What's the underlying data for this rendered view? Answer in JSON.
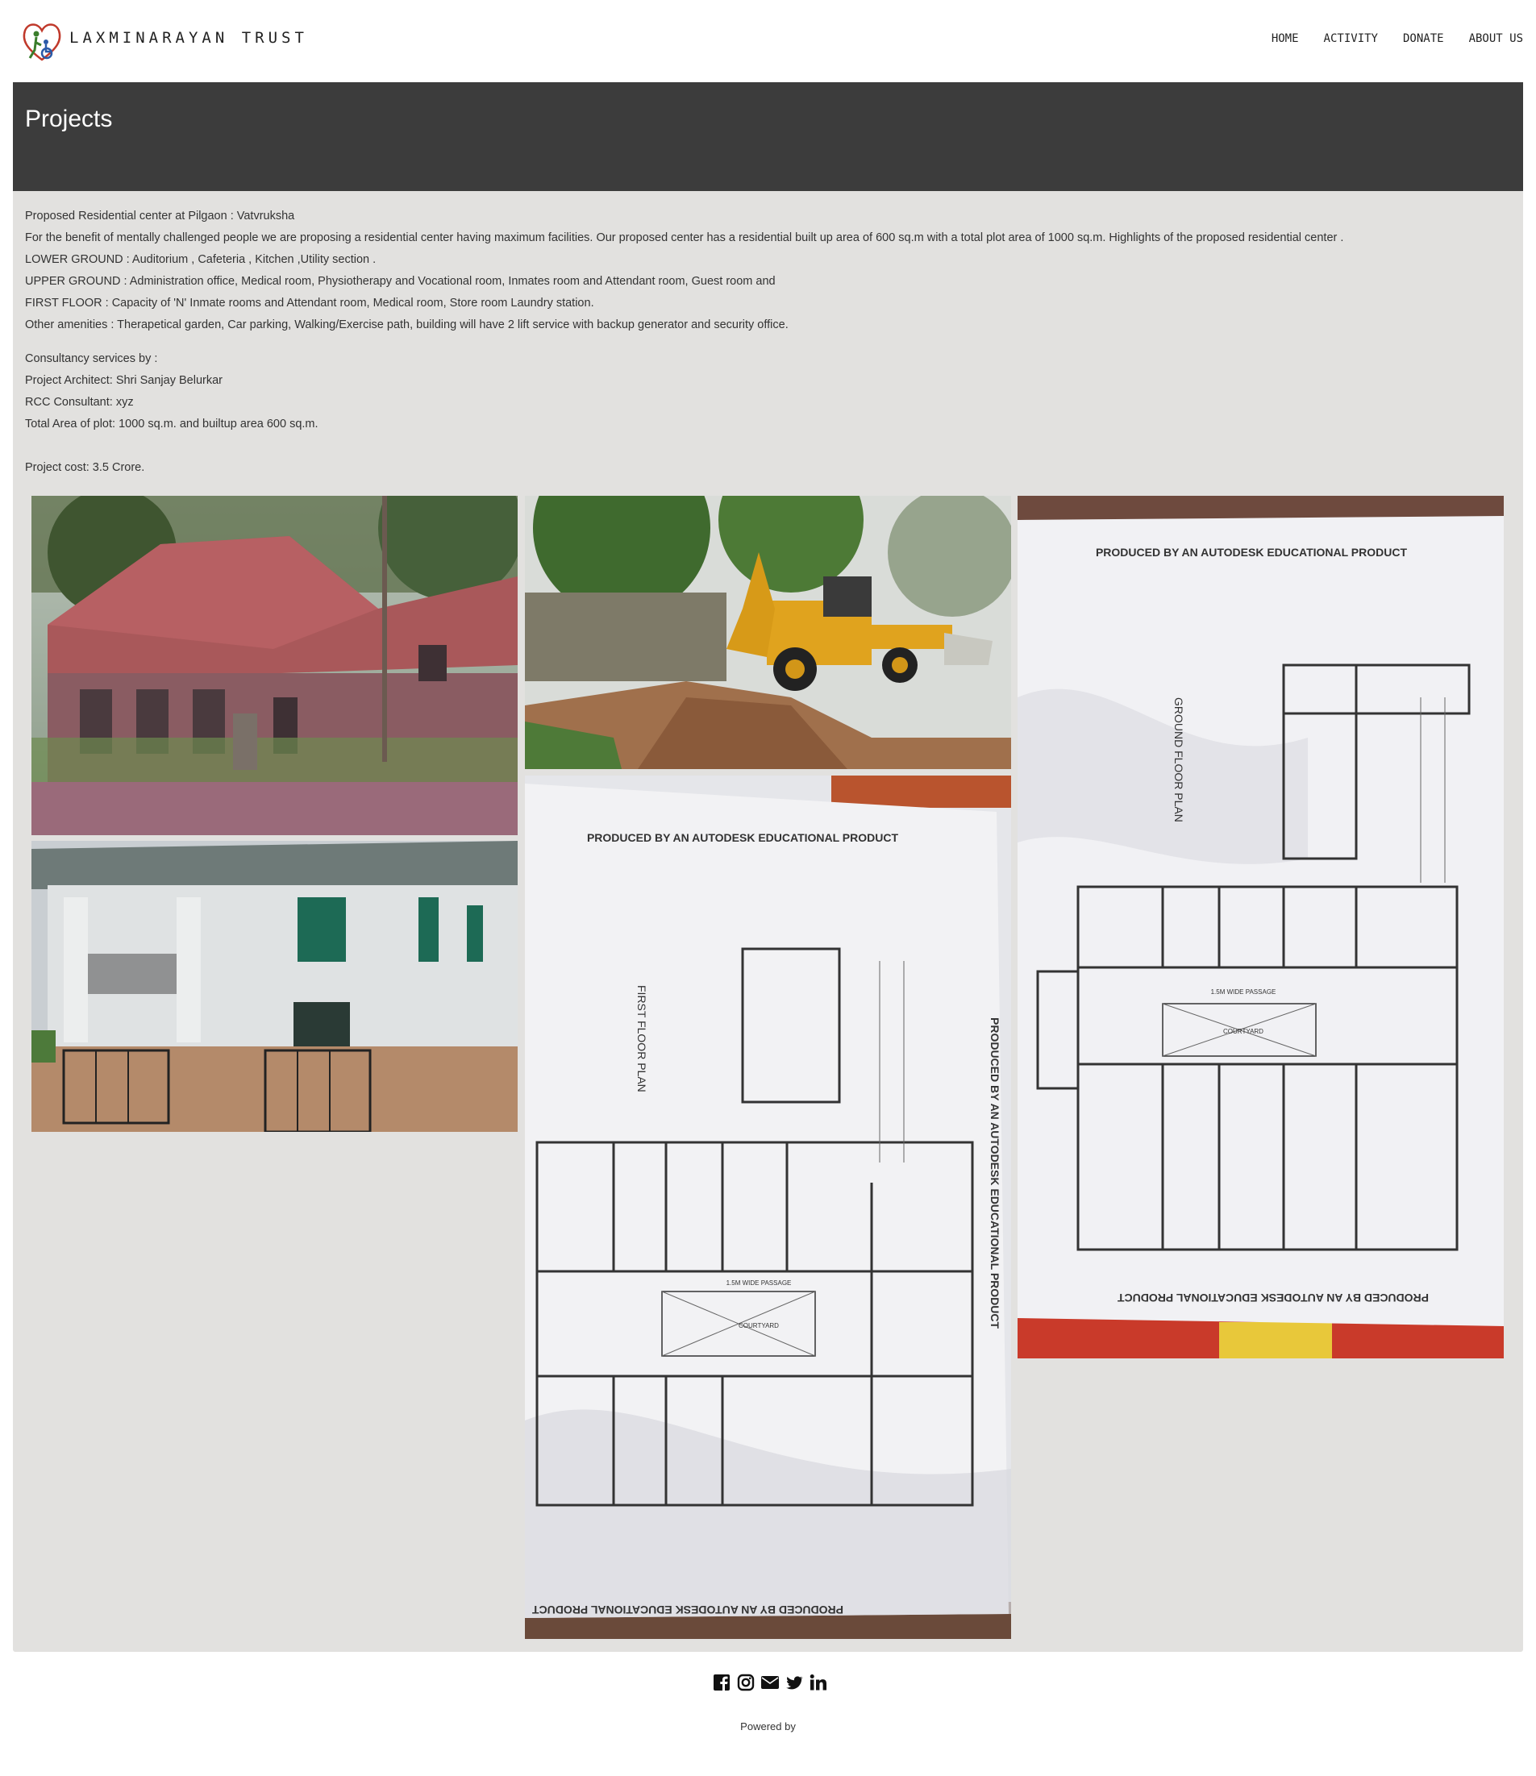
{
  "header": {
    "brand": "LAXMINARAYAN TRUST",
    "nav": [
      "HOME",
      "ACTIVITY",
      "DONATE",
      "ABOUT US"
    ]
  },
  "banner": {
    "title": "Projects"
  },
  "content": {
    "lines": [
      "Proposed Residential center at Pilgaon : Vatvruksha",
      "For the benefit of mentally challenged people we are proposing a residential center having maximum facilities. Our proposed center has a residential built up area of 600 sq.m with a total plot area of 1000 sq.m. Highlights of the proposed residential center .",
      "LOWER GROUND : Auditorium , Cafeteria , Kitchen ,Utility section .",
      "UPPER GROUND : Administration office, Medical room, Physiotherapy and Vocational room, Inmates room and Attendant room, Guest room and",
      "FIRST FLOOR : Capacity of 'N' Inmate rooms and Attendant room, Medical room, Store room Laundry station.",
      "Other amenities : Therapetical garden, Car parking, Walking/Exercise path, building will have 2 lift service with backup generator and security office."
    ],
    "consultancy": [
      "Consultancy services by :",
      "Project Architect: Shri Sanjay Belurkar",
      "RCC Consultant: xyz",
      "Total Area of plot: 1000 sq.m. and builtup area 600 sq.m."
    ],
    "cost": "Project cost: 3.5 Crore."
  },
  "plans": {
    "watermark": "PRODUCED BY AN AUTODESK EDUCATIONAL PRODUCT",
    "first_floor": "FIRST FLOOR PLAN",
    "ground_floor": "GROUND FLOOR PLAN",
    "passage": "1.5M WIDE PASSAGE",
    "courtyard": "COURTYARD"
  },
  "footer": {
    "icons": [
      "facebook-icon",
      "instagram-icon",
      "envelope-icon",
      "twitter-icon",
      "linkedin-icon"
    ],
    "powered": "Powered by"
  },
  "colors": {
    "banner": "#3c3c3c",
    "panel": "#e2e1df",
    "logo_red": "#c0392b",
    "logo_green": "#3a7d2b",
    "logo_blue": "#2a5aa8"
  }
}
